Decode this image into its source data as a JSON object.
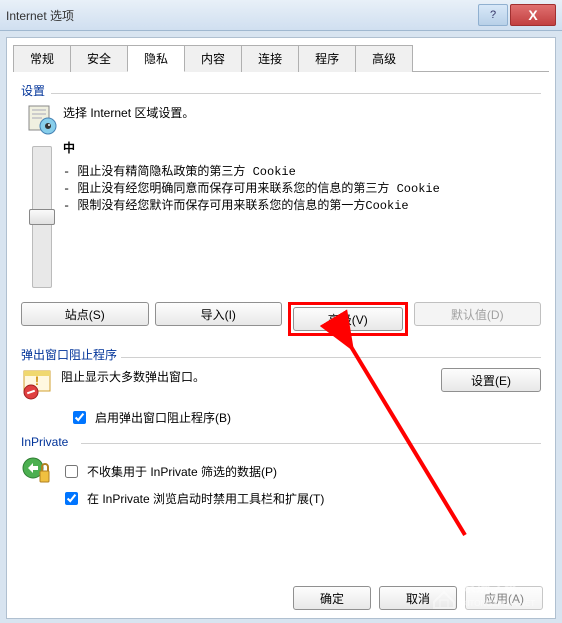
{
  "window": {
    "title": "Internet 选项",
    "help": "?",
    "close": "X"
  },
  "tabs": {
    "general": "常规",
    "security": "安全",
    "privacy": "隐私",
    "content": "内容",
    "connections": "连接",
    "programs": "程序",
    "advanced": "高级",
    "active": "privacy"
  },
  "privacy": {
    "settings_label": "设置",
    "settings_desc": "选择 Internet 区域设置。",
    "level_name": "中",
    "bullets": [
      "- 阻止没有精简隐私政策的第三方 Cookie",
      "- 阻止没有经您明确同意而保存可用来联系您的信息的第三方 Cookie",
      "- 限制没有经您默许而保存可用来联系您的信息的第一方Cookie"
    ],
    "buttons": {
      "sites": "站点(S)",
      "import": "导入(I)",
      "advanced": "高级(V)",
      "default": "默认值(D)"
    },
    "popup": {
      "label": "弹出窗口阻止程序",
      "desc": "阻止显示大多数弹出窗口。",
      "settings_btn": "设置(E)",
      "checkbox": "启用弹出窗口阻止程序(B)",
      "checked": true
    },
    "inprivate": {
      "label": "InPrivate",
      "check1": "不收集用于 InPrivate 筛选的数据(P)",
      "check1_checked": false,
      "check2": "在 InPrivate 浏览启动时禁用工具栏和扩展(T)",
      "check2_checked": true
    }
  },
  "footer": {
    "ok": "确定",
    "cancel": "取消",
    "apply": "应用(A)"
  },
  "watermark": {
    "line1": "系统之家",
    "line2": "XITONGZHIJIA.NET"
  },
  "annotation": {
    "highlight_color": "#ff0000",
    "arrow_color": "#ff0000"
  }
}
